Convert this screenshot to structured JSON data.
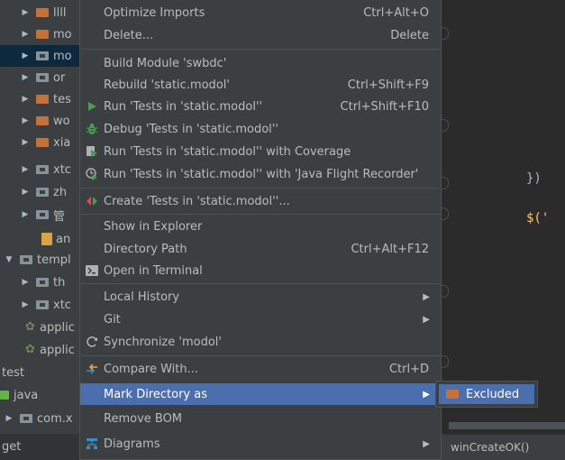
{
  "tree": {
    "rows": [
      {
        "label": "llll",
        "icon": "orange-folder-icon",
        "arrow": "▶"
      },
      {
        "label": "mo",
        "icon": "orange-folder-icon",
        "arrow": "▶"
      },
      {
        "label": "mo",
        "icon": "package-folder-icon",
        "arrow": "▶"
      },
      {
        "label": "or",
        "icon": "package-folder-icon",
        "arrow": "▶"
      },
      {
        "label": "tes",
        "icon": "orange-folder-icon",
        "arrow": "▶"
      },
      {
        "label": "wo",
        "icon": "orange-folder-icon",
        "arrow": "▶"
      },
      {
        "label": "xia",
        "icon": "orange-folder-icon",
        "arrow": "▶"
      },
      {
        "label": "xtc",
        "icon": "package-folder-icon",
        "arrow": "▶"
      },
      {
        "label": "zh",
        "icon": "package-folder-icon",
        "arrow": "▶"
      },
      {
        "label": "管",
        "icon": "package-folder-icon",
        "arrow": "▶"
      },
      {
        "label": "an",
        "icon": "js-file-icon",
        "arrow": ""
      },
      {
        "label": "templ",
        "icon": "package-folder-icon",
        "arrow": "▼"
      },
      {
        "label": "th",
        "icon": "package-folder-icon",
        "arrow": "▶"
      },
      {
        "label": "xtc",
        "icon": "package-folder-icon",
        "arrow": "▶"
      },
      {
        "label": "applic",
        "icon": "spring-config-icon",
        "arrow": ""
      },
      {
        "label": "applic",
        "icon": "spring-config-icon",
        "arrow": ""
      },
      {
        "label": "test",
        "icon": "",
        "arrow": ""
      },
      {
        "label": "java",
        "icon": "source-folder-icon",
        "arrow": ""
      },
      {
        "label": "com.x",
        "icon": "package-folder-icon",
        "arrow": "▶"
      },
      {
        "label": "get",
        "icon": "",
        "arrow": ""
      }
    ]
  },
  "editor": {
    "code_line_1": "})",
    "code_line_2": "$('",
    "status_tab": "winCreateOK()"
  },
  "menu": {
    "items": [
      {
        "label": "Optimize Imports",
        "shortcut": "Ctrl+Alt+O",
        "icon": ""
      },
      {
        "label": "Delete...",
        "shortcut": "Delete",
        "icon": ""
      },
      {
        "label": "Build Module 'swbdc'",
        "shortcut": "",
        "icon": ""
      },
      {
        "label": "Rebuild 'static.modol'",
        "shortcut": "Ctrl+Shift+F9",
        "icon": ""
      },
      {
        "label": "Run 'Tests in 'static.modol''",
        "shortcut": "Ctrl+Shift+F10",
        "icon": "run-icon"
      },
      {
        "label": "Debug 'Tests in 'static.modol''",
        "shortcut": "",
        "icon": "debug-icon"
      },
      {
        "label": "Run 'Tests in 'static.modol'' with Coverage",
        "shortcut": "",
        "icon": "coverage-icon"
      },
      {
        "label": "Run 'Tests in 'static.modol'' with 'Java Flight Recorder'",
        "shortcut": "",
        "icon": "profiler-icon"
      },
      {
        "label": "Create 'Tests in 'static.modol''...",
        "shortcut": "",
        "icon": "create-config-icon"
      },
      {
        "label": "Show in Explorer",
        "shortcut": "",
        "icon": ""
      },
      {
        "label": "Directory Path",
        "shortcut": "Ctrl+Alt+F12",
        "icon": ""
      },
      {
        "label": "Open in Terminal",
        "shortcut": "",
        "icon": "terminal-icon"
      },
      {
        "label": "Local History",
        "shortcut": "",
        "icon": "",
        "submenu": "▶"
      },
      {
        "label": "Git",
        "shortcut": "",
        "icon": "",
        "submenu": "▶"
      },
      {
        "label": "Synchronize 'modol'",
        "shortcut": "",
        "icon": "sync-icon"
      },
      {
        "label": "Compare With...",
        "shortcut": "Ctrl+D",
        "icon": "compare-icon"
      },
      {
        "label": "Mark Directory as",
        "shortcut": "",
        "icon": "",
        "submenu": "▶"
      },
      {
        "label": "Remove BOM",
        "shortcut": "",
        "icon": ""
      },
      {
        "label": "Diagrams",
        "shortcut": "",
        "icon": "diagram-icon",
        "submenu": "▶"
      }
    ]
  },
  "submenu": {
    "item": "Excluded"
  },
  "colors": {
    "highlight": "#4b6eaf",
    "menu_bg": "#3c3f41",
    "editor_bg": "#2b2b2b"
  }
}
